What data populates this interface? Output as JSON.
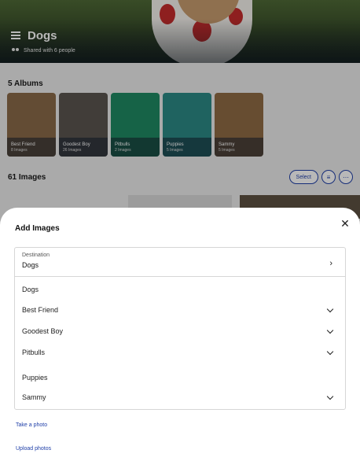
{
  "header": {
    "title": "Dogs",
    "shared_text": "Shared with 6 people",
    "menu_icon": "hamburger-menu-icon",
    "people_icon": "people-icon"
  },
  "albums_section": {
    "title": "5 Albums",
    "albums": [
      {
        "name": "Best Friend",
        "count": "8 Images",
        "color": "#8a6a48"
      },
      {
        "name": "Goodest Boy",
        "count": "26 Images",
        "color": "#5a5550"
      },
      {
        "name": "Pitbulls",
        "count": "2 Images",
        "color": "#1f8a63"
      },
      {
        "name": "Puppies",
        "count": "5 Images",
        "color": "#2b8a86"
      },
      {
        "name": "Sammy",
        "count": "5 Images",
        "color": "#8f6b45"
      }
    ]
  },
  "images_section": {
    "title": "61 Images",
    "select_label": "Select",
    "filter_icon": "filter-icon",
    "more_icon": "more-horizontal-icon"
  },
  "modal": {
    "title": "Add Images",
    "close_icon": "close-icon",
    "destination_label": "Destination",
    "destination_value": "Dogs",
    "options": [
      {
        "label": "Dogs",
        "expandable": false
      },
      {
        "label": "Best Friend",
        "expandable": true
      },
      {
        "label": "Goodest Boy",
        "expandable": true
      },
      {
        "label": "Pitbulls",
        "expandable": true
      },
      {
        "label": "Puppies",
        "expandable": false
      },
      {
        "label": "Sammy",
        "expandable": true
      }
    ],
    "take_photo": "Take a photo",
    "upload_photos": "Upload photos"
  },
  "colors": {
    "accent": "#1f3fa8",
    "overlay": "rgba(0,0,0,0.28)"
  }
}
